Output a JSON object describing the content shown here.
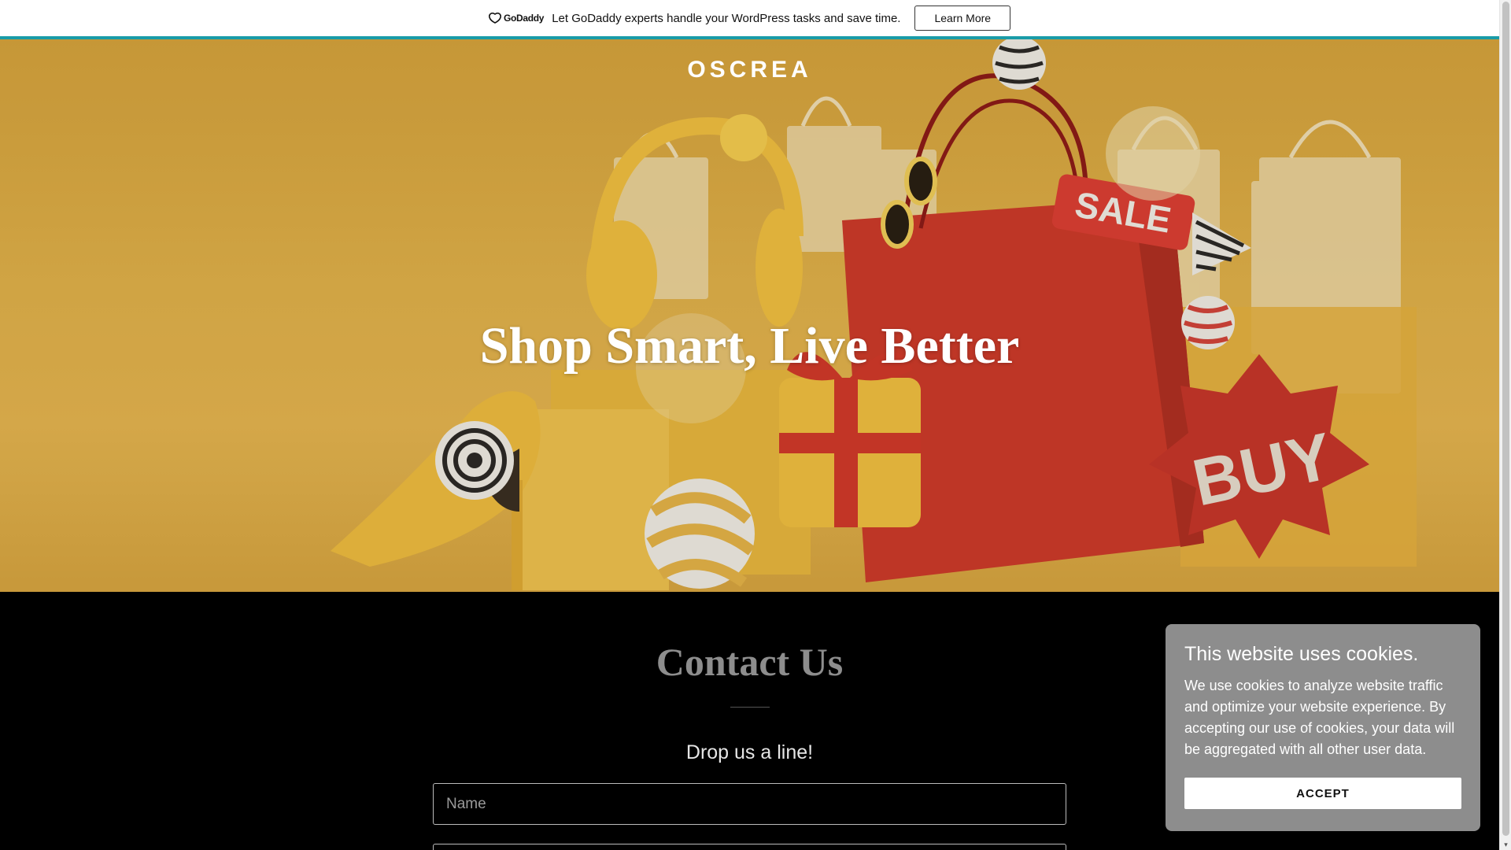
{
  "promo": {
    "logo_text": "GoDaddy",
    "message": "Let GoDaddy experts handle your WordPress tasks and save time.",
    "button_label": "Learn More",
    "accent_color": "#1a9ca8"
  },
  "hero": {
    "site_title": "OSCREA",
    "heading": "Shop Smart, Live Better",
    "image_art": {
      "sale_tag": "SALE",
      "buy_badge": "BUY"
    }
  },
  "contact": {
    "title": "Contact Us",
    "subtitle": "Drop us a line!",
    "name_placeholder": "Name"
  },
  "cookie": {
    "title": "This website uses cookies.",
    "body": "We use cookies to analyze website traffic and optimize your website experience. By accepting our use of cookies, your data will be aggregated with all other user data.",
    "accept_label": "ACCEPT"
  }
}
